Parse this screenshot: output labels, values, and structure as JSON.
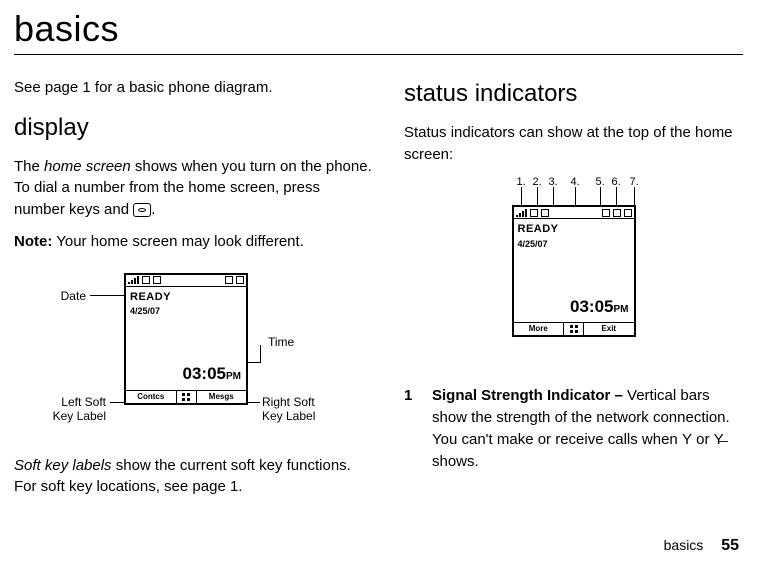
{
  "title": "basics",
  "left_col": {
    "intro": "See page 1 for a basic phone diagram.",
    "display_heading": "display",
    "display_para1_prefix": "The ",
    "display_para1_italic": "home screen",
    "display_para1_suffix": " shows when you turn on the phone. To dial a number from the home screen, press number keys and ",
    "display_para1_after_icon": ".",
    "note_label": "Note:",
    "note_text": " Your home screen may look different.",
    "softkey_para_prefix_italic": "Soft key labels",
    "softkey_para_suffix": " show the current soft key functions. For soft key locations, see page 1.",
    "callouts": {
      "date": "Date",
      "time": "Time",
      "left_soft1": "Left Soft",
      "left_soft2": "Key Label",
      "right_soft1": "Right Soft",
      "right_soft2": "Key Label"
    },
    "phone": {
      "ready": "READY",
      "date": "4/25/07",
      "time": "03:05",
      "ampm": "PM",
      "softkey_left": "Contcs",
      "softkey_right": "Mesgs"
    }
  },
  "right_col": {
    "heading": "status indicators",
    "intro": "Status indicators can show at the top of the home screen:",
    "indicator_numbers": [
      "1.",
      "2.",
      "3.",
      "4.",
      "5.",
      "6.",
      "7."
    ],
    "phone": {
      "ready": "READY",
      "date": "4/25/07",
      "time": "03:05",
      "ampm": "PM",
      "softkey_left": "More",
      "softkey_right": "Exit"
    },
    "item1_num": "1",
    "item1_bold": "Signal Strength Indicator –",
    "item1_text": " Vertical bars show the strength of the network connection. You can't make or receive calls when ",
    "item1_glyph1": "📶",
    "item1_mid": " or ",
    "item1_glyph2": "📵",
    "item1_end": " shows."
  },
  "footer_label": "basics",
  "page_number": "55"
}
